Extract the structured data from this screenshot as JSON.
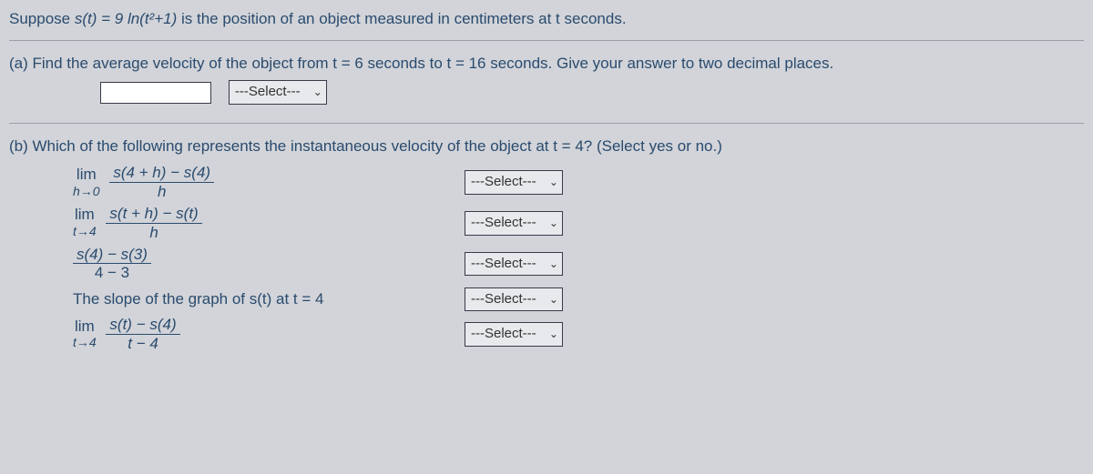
{
  "intro": {
    "prefix": "Suppose ",
    "func": "s(t) = 9 ln(t²+1)",
    "suffix": "  is the position of an object measured in centimeters at t seconds."
  },
  "partA": {
    "prompt": "(a) Find the average velocity of the object from t = 6 seconds to t = 16 seconds. Give your answer to two decimal places.",
    "input_value": "",
    "select_label": "---Select---"
  },
  "partB": {
    "prompt": "(b) Which of the following represents the instantaneous velocity of the object at t = 4? (Select yes or no.)",
    "options": [
      {
        "lim_top": "lim",
        "lim_bot": "h→0",
        "num": "s(4 + h) − s(4)",
        "den": "h",
        "select": "---Select---"
      },
      {
        "lim_top": "lim",
        "lim_bot": "t→4",
        "num": "s(t + h) − s(t)",
        "den": "h",
        "select": "---Select---"
      },
      {
        "lim_top": "",
        "lim_bot": "",
        "num": "s(4) − s(3)",
        "den": "4 − 3",
        "select": "---Select---"
      },
      {
        "plain_text": "The slope of the graph of s(t) at t = 4",
        "select": "---Select---"
      },
      {
        "lim_top": "lim",
        "lim_bot": "t→4",
        "num": "s(t) − s(4)",
        "den": "t − 4",
        "select": "---Select---"
      }
    ]
  }
}
